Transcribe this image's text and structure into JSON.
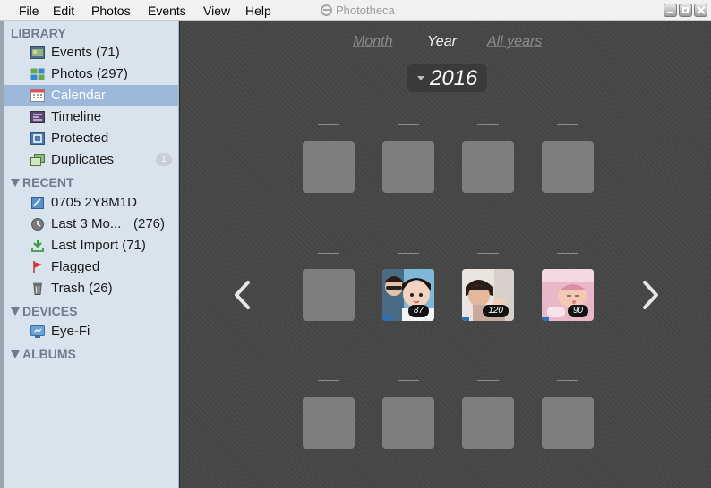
{
  "menu": {
    "items": [
      "File",
      "Edit",
      "Photos",
      "Events",
      "View",
      "Help"
    ],
    "app_title": "Phototheca"
  },
  "sidebar": {
    "library_heading": "LIBRARY",
    "library": [
      {
        "label": "Events (71)",
        "icon": "events-icon"
      },
      {
        "label": "Photos (297)",
        "icon": "photos-icon"
      },
      {
        "label": "Calendar",
        "icon": "calendar-icon",
        "selected": true
      },
      {
        "label": "Timeline",
        "icon": "timeline-icon"
      },
      {
        "label": "Protected",
        "icon": "protected-icon"
      },
      {
        "label": "Duplicates",
        "icon": "duplicates-icon",
        "badge": "1"
      }
    ],
    "recent_heading": "RECENT",
    "recent": [
      {
        "label": "0705 2Y8M1D",
        "icon": "album-icon"
      },
      {
        "label": "Last 3 Mo...",
        "count": "(276)",
        "icon": "clock-icon"
      },
      {
        "label": "Last Import (71)",
        "icon": "import-icon"
      },
      {
        "label": "Flagged",
        "icon": "flag-icon"
      },
      {
        "label": "Trash (26)",
        "icon": "trash-icon"
      }
    ],
    "devices_heading": "DEVICES",
    "devices": [
      {
        "label": "Eye-Fi",
        "icon": "device-icon"
      }
    ],
    "albums_heading": "ALBUMS"
  },
  "main": {
    "tabs": [
      "Month",
      "Year",
      "All years"
    ],
    "active_tab": "Year",
    "year": "2016",
    "month_cells": [
      {
        "count": null
      },
      {
        "count": null
      },
      {
        "count": null
      },
      {
        "count": null
      },
      {
        "count": null
      },
      {
        "count": "87"
      },
      {
        "count": "120"
      },
      {
        "count": "90"
      },
      {
        "count": null
      },
      {
        "count": null
      },
      {
        "count": null
      },
      {
        "count": null
      }
    ]
  },
  "colors": {
    "sidebar_bg": "#d9e3ee",
    "selection": "#9cb9dc",
    "main_bg": "#464646",
    "empty_cell": "#7e7e7e"
  }
}
